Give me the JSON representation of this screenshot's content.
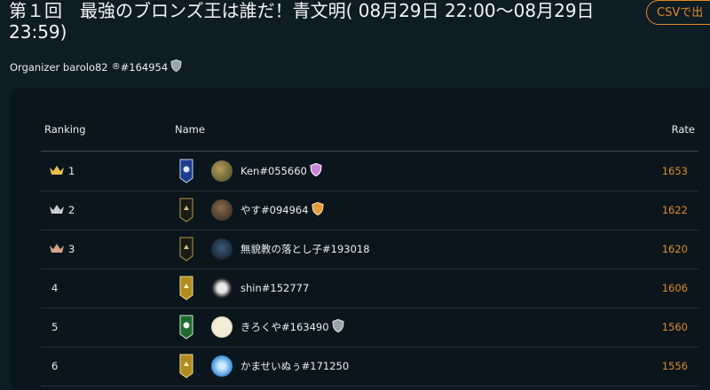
{
  "header": {
    "title": "第１回　最強のブロンズ王は誰だ！青文明( 08月29日 22:00〜08月29日 23:59)",
    "csv_button": "CSVで出"
  },
  "organizer": {
    "label": "Organizer",
    "name": "barolo82",
    "symbol": "®",
    "id": "#164954"
  },
  "table": {
    "headers": {
      "ranking": "Ranking",
      "name": "Name",
      "rate": "Rate"
    },
    "rows": [
      {
        "rank": "1",
        "name": "Ken#055660",
        "rate": "1653"
      },
      {
        "rank": "2",
        "name": "やす#094964",
        "rate": "1622"
      },
      {
        "rank": "3",
        "name": "無貌教の落とし子#193018",
        "rate": "1620"
      },
      {
        "rank": "4",
        "name": "shin#152777",
        "rate": "1606"
      },
      {
        "rank": "5",
        "name": "きろくや#163490",
        "rate": "1560"
      },
      {
        "rank": "6",
        "name": "かませいぬぅ#171250",
        "rate": "1556"
      }
    ]
  },
  "colors": {
    "background": "#0e1c23",
    "panel": "#0a161c",
    "accent_orange": "#e08a2b",
    "crown_gold": "#e6c04a",
    "crown_silver": "#c7ccd1",
    "crown_bronze": "#d7a184"
  },
  "icons": {
    "crowns": [
      "crown-gold-icon",
      "crown-silver-icon",
      "crown-bronze-icon"
    ],
    "banners": [
      "banner-blue-icon",
      "banner-black-icon",
      "banner-black-icon",
      "banner-gold-icon",
      "banner-green-icon",
      "banner-gold-icon"
    ]
  }
}
